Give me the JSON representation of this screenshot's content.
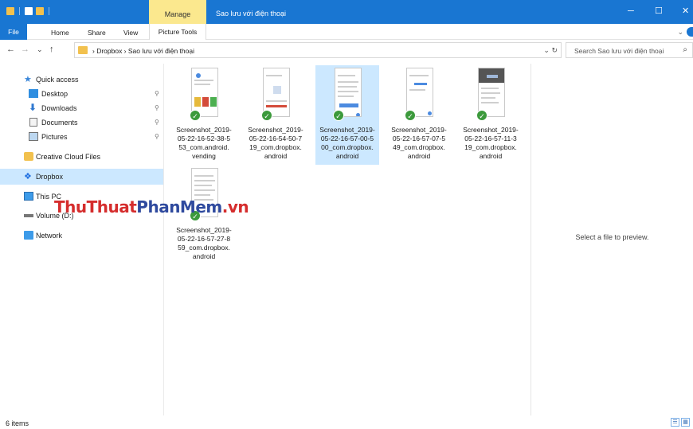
{
  "titlebar": {
    "manage_label": "Manage",
    "title": "Sao lưu với điện thoại",
    "minimize_glyph": "─",
    "maximize_glyph": "☐",
    "close_glyph": "✕",
    "accent_color": "#1976d2",
    "manage_color": "#fbe88e"
  },
  "ribbon": {
    "tabs": [
      "File",
      "Home",
      "Share",
      "View",
      "Picture Tools"
    ],
    "collapse_glyph": "⌄"
  },
  "address": {
    "back_glyph": "←",
    "forward_glyph": "→",
    "recent_glyph": "⌄",
    "up_glyph": "↑",
    "path": "›  Dropbox  ›  Sao lưu với điện thoại",
    "controls": "⌄  ↻",
    "search_placeholder": "Search Sao lưu với điện thoại",
    "search_icon": "⌕"
  },
  "nav": {
    "items": [
      {
        "label": "Quick access",
        "icon": "star-icon"
      },
      {
        "label": "Desktop",
        "icon": "desktop-icon",
        "pinned": true
      },
      {
        "label": "Downloads",
        "icon": "download-icon",
        "pinned": true
      },
      {
        "label": "Documents",
        "icon": "documents-icon",
        "pinned": true
      },
      {
        "label": "Pictures",
        "icon": "pictures-icon",
        "pinned": true
      },
      {
        "label": "Creative Cloud Files",
        "icon": "creative-cloud-icon"
      },
      {
        "label": "Dropbox",
        "icon": "dropbox-icon"
      },
      {
        "label": "This PC",
        "icon": "computer-icon"
      },
      {
        "label": "Volume (D:)",
        "icon": "drive-icon"
      },
      {
        "label": "Network",
        "icon": "network-icon"
      }
    ],
    "pin_glyph": "⚲"
  },
  "files": [
    {
      "name": "Screenshot_2019-05-22-16-52-38-553_com.android.vending",
      "lines": [
        "Screenshot_2019-",
        "05-22-16-52-38-5",
        "53_com.android.",
        "vending"
      ]
    },
    {
      "name": "Screenshot_2019-05-22-16-54-50-719_com.dropbox.android",
      "lines": [
        "Screenshot_2019-",
        "05-22-16-54-50-7",
        "19_com.dropbox.",
        "android"
      ]
    },
    {
      "name": "Screenshot_2019-05-22-16-57-00-500_com.dropbox.android",
      "lines": [
        "Screenshot_2019-",
        "05-22-16-57-00-5",
        "00_com.dropbox.",
        "android"
      ]
    },
    {
      "name": "Screenshot_2019-05-22-16-57-07-549_com.dropbox.android",
      "lines": [
        "Screenshot_2019-",
        "05-22-16-57-07-5",
        "49_com.dropbox.",
        "android"
      ]
    },
    {
      "name": "Screenshot_2019-05-22-16-57-11-319_com.dropbox.android",
      "lines": [
        "Screenshot_2019-",
        "05-22-16-57-11-3",
        "19_com.dropbox.",
        "android"
      ]
    },
    {
      "name": "Screenshot_2019-05-22-16-57-27-859_com.dropbox.android",
      "lines": [
        "Screenshot_2019-",
        "05-22-16-57-27-8",
        "59_com.dropbox.",
        "android"
      ]
    }
  ],
  "sync_glyph": "✓",
  "watermark": {
    "part1": "ThuThuat",
    "part2": "PhanMem",
    "part3": ".vn"
  },
  "preview": {
    "text": "Select a file to preview."
  },
  "status": {
    "count": "6 items",
    "details_glyph": "☰",
    "tiles_glyph": "▦"
  }
}
